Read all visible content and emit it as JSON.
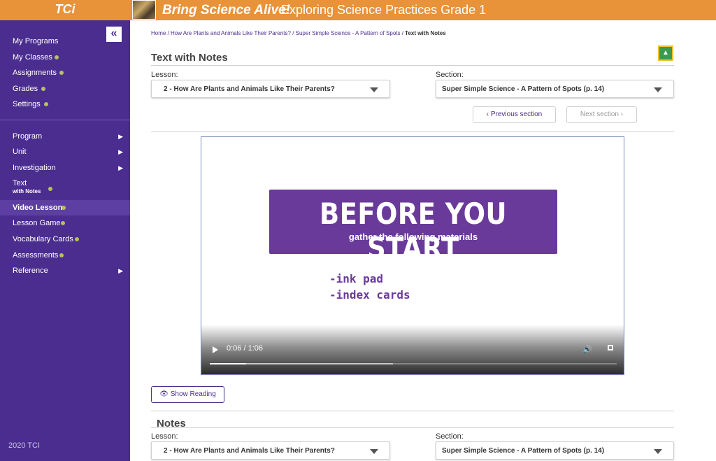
{
  "topbar": {
    "logo": "TCi",
    "brand": "Bring Science Alive!",
    "title": "Exploring Science Practices Grade 1"
  },
  "sidebar": {
    "collapse_label": "«",
    "top_items": [
      {
        "label": "My Programs"
      },
      {
        "label": "My Classes"
      },
      {
        "label": "Assignments"
      },
      {
        "label": "Grades"
      },
      {
        "label": "Settings"
      }
    ],
    "items": [
      {
        "label": "Program"
      },
      {
        "label": "Unit"
      },
      {
        "label": "Investigation"
      },
      {
        "label": "Text",
        "sublabel": "with Notes"
      },
      {
        "label": "Video Lesson",
        "active": true
      },
      {
        "label": "Lesson Game"
      },
      {
        "label": "Vocabulary Cards"
      },
      {
        "label": "Assessments"
      },
      {
        "label": "Reference"
      }
    ],
    "copyright": "2020 TCI"
  },
  "breadcrumb": {
    "home": "Home",
    "lesson": "How Are Plants and Animals Like Their Parents?",
    "section": "Super Simple Science - A Pattern of Spots",
    "current": "Text with Notes"
  },
  "main": {
    "title": "Text with Notes",
    "lesson_label": "Lesson:",
    "lesson_value": "2 - How Are Plants and Animals Like Their Parents?",
    "section_label": "Section:",
    "section_value": "Super Simple Science - A Pattern of Spots (p. 14)",
    "prev_button": "‹  Previous section",
    "next_button": "Next section  ›"
  },
  "video": {
    "heading": "BEFORE YOU START",
    "subheading": "gather the following materials",
    "materials": [
      "-ink pad",
      "-index cards"
    ],
    "time": "0:06 / 1:06",
    "progress": 0.09,
    "buffered": 0.45
  },
  "show_reading": "Show Reading",
  "notes": {
    "title": "Notes",
    "lesson_label": "Lesson:",
    "lesson_value": "2 - How Are Plants and Animals Like Their Parents?",
    "section_label": "Section:",
    "section_value": "Super Simple Science - A Pattern of Spots (p. 14)"
  },
  "colors": {
    "topbar": "#e8923a",
    "sidebar": "#4b2d8f",
    "accent_dot": "#b5c25a",
    "banner": "#6a3a9a"
  }
}
